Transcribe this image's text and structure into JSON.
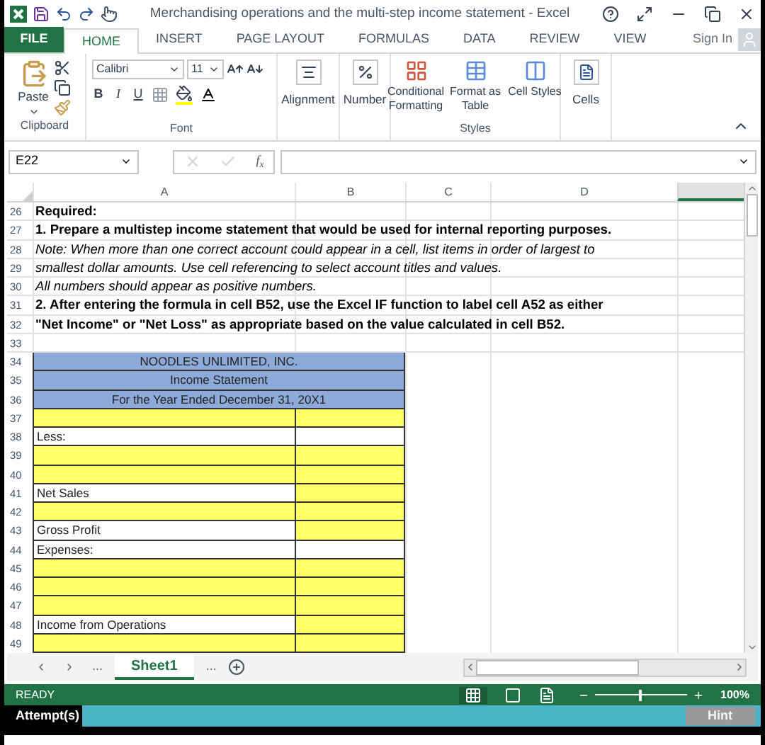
{
  "window": {
    "title": "Merchandising operations and the multi-step income statement - Excel",
    "sign_in": "Sign In"
  },
  "file_tab": "FILE",
  "tabs": [
    {
      "label": "HOME",
      "selected": true
    },
    {
      "label": "INSERT",
      "selected": false
    },
    {
      "label": "PAGE LAYOUT",
      "selected": false
    },
    {
      "label": "FORMULAS",
      "selected": false
    },
    {
      "label": "DATA",
      "selected": false
    },
    {
      "label": "REVIEW",
      "selected": false
    },
    {
      "label": "VIEW",
      "selected": false
    }
  ],
  "ribbon": {
    "paste": "Paste",
    "clipboard": "Clipboard",
    "font_name": "Calibri",
    "font_size": "11",
    "format_buttons": [
      "B",
      "I",
      "U"
    ],
    "font": "Font",
    "alignment": "Alignment",
    "number": "Number",
    "styles_buttons": [
      "Conditional Formatting",
      "Format as Table",
      "Cell Styles"
    ],
    "styles": "Styles",
    "cells": "Cells"
  },
  "formula_bar": {
    "name_box": "E22",
    "fx": "f$_{x}$"
  },
  "columns": [
    "A",
    "B",
    "C",
    "D"
  ],
  "rows": [
    {
      "num": "26",
      "kind": "bold_text",
      "text": "Required:"
    },
    {
      "num": "27",
      "kind": "bold_text",
      "text": "1.  Prepare a multistep income statement that would be used for internal reporting purposes."
    },
    {
      "num": "28",
      "kind": "italic_text",
      "text": "Note:  When more than one correct account could appear in a cell, list items in order of largest to"
    },
    {
      "num": "29",
      "kind": "italic_text",
      "text": "smallest dollar amounts.  Use cell referencing to select account titles and values."
    },
    {
      "num": "30",
      "kind": "italic_text",
      "text": "All numbers should appear as positive numbers."
    },
    {
      "num": "31",
      "kind": "bold_text",
      "text": "2. After entering the formula in cell B52, use the Excel IF function to label cell A52 as either"
    },
    {
      "num": "32",
      "kind": "bold_text",
      "text": " \"Net Income\" or \"Net Loss\" as appropriate based on the value calculated in cell B52."
    },
    {
      "num": "33",
      "kind": "blank"
    },
    {
      "num": "34",
      "kind": "header",
      "text": "NOODLES UNLIMITED, INC."
    },
    {
      "num": "35",
      "kind": "header",
      "text": "Income Statement"
    },
    {
      "num": "36",
      "kind": "header",
      "text": "For the Year Ended December 31, 20X1"
    },
    {
      "num": "37",
      "kind": "entry"
    },
    {
      "num": "38",
      "kind": "label",
      "text": "Less:"
    },
    {
      "num": "39",
      "kind": "entry"
    },
    {
      "num": "40",
      "kind": "entry"
    },
    {
      "num": "41",
      "kind": "label_entry",
      "text": "Net Sales"
    },
    {
      "num": "42",
      "kind": "entry"
    },
    {
      "num": "43",
      "kind": "label_entry",
      "text": "Gross Profit"
    },
    {
      "num": "44",
      "kind": "label",
      "text": "Expenses:"
    },
    {
      "num": "45",
      "kind": "entry"
    },
    {
      "num": "46",
      "kind": "entry"
    },
    {
      "num": "47",
      "kind": "entry"
    },
    {
      "num": "48",
      "kind": "label_entry",
      "text": "Income from Operations"
    },
    {
      "num": "49",
      "kind": "entry"
    }
  ],
  "sheet_tabs": {
    "left_more": "...",
    "tabs": [
      {
        "label": "Sheet1",
        "selected": true
      }
    ],
    "right_more": "..."
  },
  "status_bar": {
    "status": "READY",
    "zoom": "100%",
    "level": 0.5
  },
  "attempt_bar": {
    "label": "Attempt(s)",
    "hint": "Hint",
    "disabled": true
  }
}
